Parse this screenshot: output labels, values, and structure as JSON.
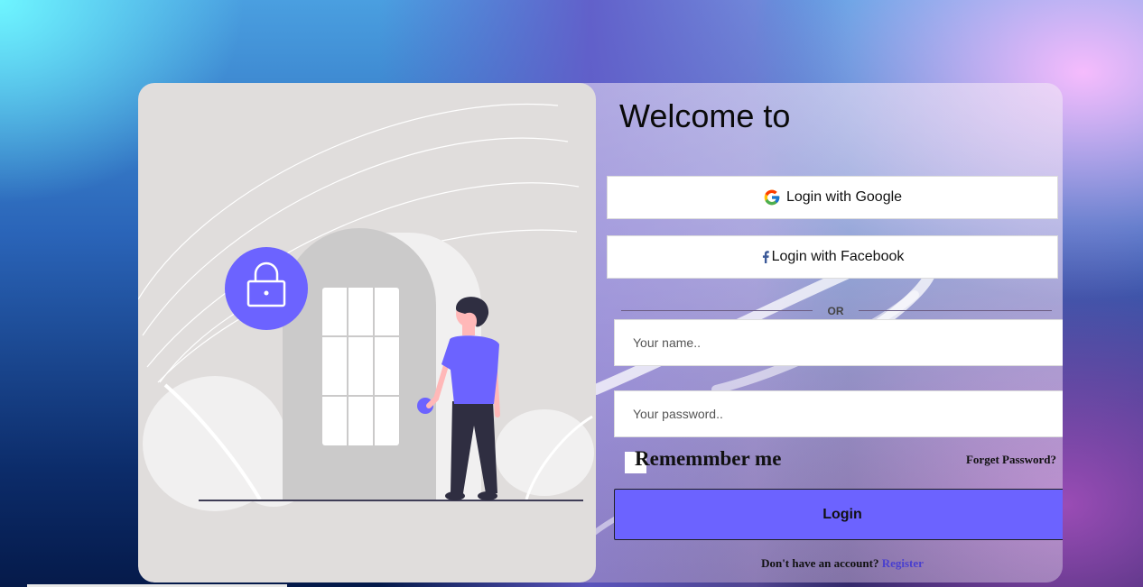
{
  "colors": {
    "accent": "#6c63ff",
    "illustration_bg": "#e0dddc",
    "link": "#4a3fcf"
  },
  "illustration": {
    "icons": [
      "lock-icon",
      "door",
      "person"
    ]
  },
  "login_panel": {
    "title": "Welcome to",
    "google_button": {
      "label": "Login with Google",
      "icon": "google-icon"
    },
    "facebook_button": {
      "label": "Login with Facebook",
      "icon": "facebook-icon"
    },
    "divider_text": "OR",
    "name_field": {
      "placeholder": "Your name..",
      "value": ""
    },
    "password_field": {
      "placeholder": "Your password..",
      "value": ""
    },
    "remember_label": "Rememmber me",
    "forgot_link": "Forget Password?",
    "login_button": "Login",
    "register_prompt": "Don't have an account?",
    "register_link": "Register"
  }
}
